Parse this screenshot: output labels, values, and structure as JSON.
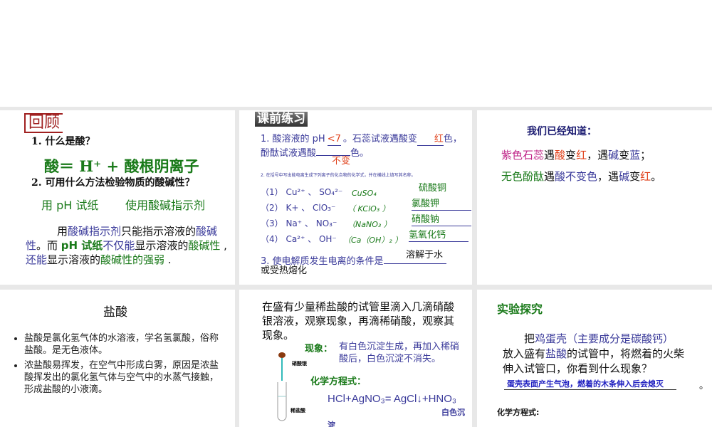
{
  "slides": [
    {
      "title": "回顾",
      "q1": "1. 什么是酸？",
      "formula": "酸＝  H⁺ +  酸根阴离子",
      "q2": "2. 可用什么方法检验物质的酸碱性？",
      "a2a": "用 pH 试纸",
      "a2b": "使用酸碱指示剂",
      "p_1": "用",
      "p_2": "酸碱指示剂",
      "p_3": "只能指示溶液的",
      "p_4": "酸碱",
      "p_5": "性",
      "p_6": "。而 ",
      "p_7": "pH 试纸",
      "p_8": "不仅能",
      "p_9": "显示溶液的",
      "p_10": "酸碱",
      "p_11": "性",
      "p_12": " , ",
      "p_13": "还能",
      "p_14": "显示溶液的",
      "p_15": "酸碱性的强弱",
      "p_16": " ."
    },
    {
      "title": "课前练习",
      "l1a": "1. 酸溶液的 pH",
      "l1b": "<7",
      "l1c": "。石蕊试液遇酸变",
      "l1d": "红",
      "l1e": "色，",
      "l2a": "酚酞试液遇酸",
      "l2b": "色。",
      "l2ans": "不变",
      "instr": "2. 在括号中写出能电离生成下列离子的化合物的化学式，并在横线上填写其名称。",
      "rows": [
        {
          "ions": "（1） Cu²⁺ 、 SO₄²⁻",
          "formula": "CuSO₄",
          "name": "硫酸铜"
        },
        {
          "ions": "（2） K+ 、 ClO₃⁻",
          "formula": "（ KClO₃    ）",
          "name": "氯酸钾"
        },
        {
          "ions": "（3） Na⁺ 、 NO₃⁻",
          "formula": "（NaNO₃     ）",
          "name": "硝酸钠"
        },
        {
          "ions": "（4） Ca²⁺ 、 OH⁻",
          "formula": "（Ca（OH）₂ ）",
          "name": "氢氧化钙"
        }
      ],
      "q3": "3. 使电解质发生电离的条件是",
      "q3a": "溶解于水",
      "q3b": "或受热熔化"
    },
    {
      "title": "我们已经知道：",
      "l1": [
        "紫色石蕊",
        "遇",
        "酸",
        "变",
        "红",
        "，遇",
        "碱",
        "变",
        "蓝",
        "；"
      ],
      "l2": [
        "无色酚酞",
        "遇",
        "酸不变色",
        "，遇",
        "碱",
        "变",
        "红",
        "。"
      ]
    },
    {
      "title": "盐酸",
      "bullets": [
        "盐酸是氯化氢气体的水溶液，学名氢氯酸，俗称盐酸。是无色液体。",
        "浓盐酸易挥发，在空气中形成白雾，原因是浓盐酸挥发出的氯化氢气体与空气中的水蒸气接触，形成盐酸的小液滴。"
      ]
    },
    {
      "text": "在盛有少量稀盐酸的试管里滴入几滴硝酸银溶液，观察现象，再滴稀硝酸，观察其现象。",
      "phen_label": "现象：",
      "phen": "有白色沉淀生成，再加入稀硝酸后，白色沉淀不消失。",
      "dropper_label": "硝酸银",
      "tube_label": "稀盐酸",
      "eq_label": "化学方程式：",
      "eq": "HCl+AgNO₃= AgCl↓+HNO₃",
      "ppt1": "白色沉",
      "ppt2": "淀"
    },
    {
      "title": "实验探究",
      "t1": "把",
      "t2": "鸡蛋壳（主要成分是碳酸钙）",
      "t3": "放入盛有",
      "t4": "盐酸",
      "t5": "的试管中，将燃着的火柴",
      "t6": "伸入试管口，你看到什么现象？",
      "ans": "蛋壳表面产生气泡，燃着的木条伸入后会熄灭",
      "period": "。",
      "eq_label": "化学方程式:"
    }
  ]
}
